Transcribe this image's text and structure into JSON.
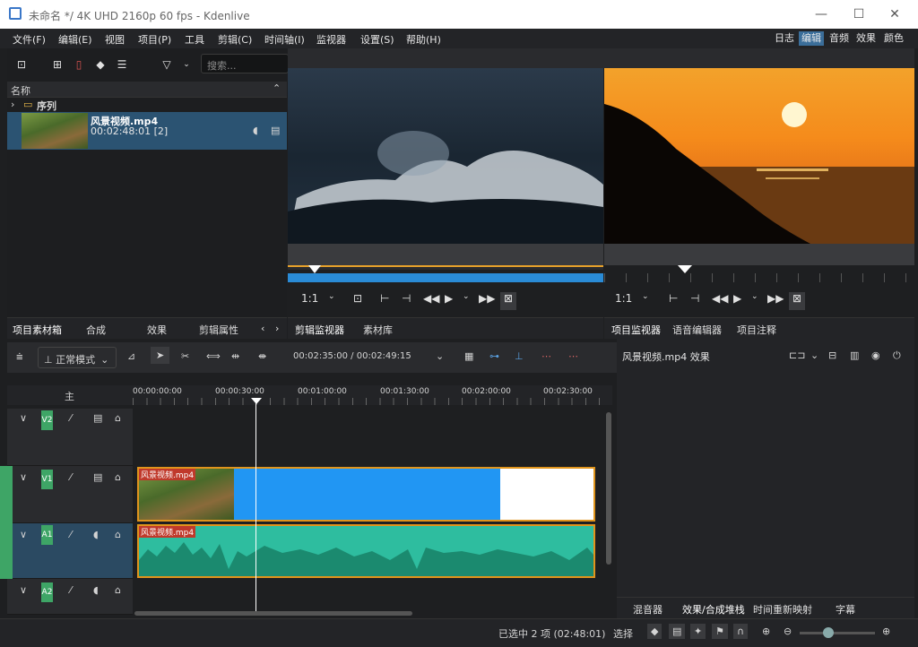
{
  "window": {
    "title": "未命名 */ 4K UHD 2160p 60 fps - Kdenlive",
    "minimize": "—",
    "maximize": "☐",
    "close": "✕"
  },
  "menus": [
    "文件(F)",
    "编辑(E)",
    "视图",
    "项目(P)",
    "工具",
    "剪辑(C)",
    "时间轴(I)",
    "监视器",
    "设置(S)",
    "帮助(H)"
  ],
  "workspaces": [
    "日志",
    "编辑",
    "音频",
    "效果",
    "颜色"
  ],
  "bin": {
    "search_placeholder": "搜索...",
    "header": "名称",
    "folder": "序列",
    "clip_name": "风景视频.mp4",
    "clip_duration": "00:02:48:01 [2]"
  },
  "left_tabs": [
    "项目素材箱",
    "合成",
    "效果",
    "剪辑属性"
  ],
  "clip_monitor": {
    "zoom": "1:1",
    "tabs": [
      "剪辑监视器",
      "素材库"
    ]
  },
  "project_monitor": {
    "zoom": "1:1",
    "tabs": [
      "项目监视器",
      "语音编辑器",
      "项目注释"
    ]
  },
  "timeline": {
    "mode": "正常模式",
    "timecode": "00:02:35:00 / 00:02:49:15",
    "master": "主",
    "ruler": [
      "00:00:00:00",
      "00:00:30:00",
      "00:01:00:00",
      "00:01:30:00",
      "00:02:00:00",
      "00:02:30:00"
    ],
    "clip_label": "风景视频.mp4"
  },
  "tracks": [
    "V2",
    "V1",
    "A1",
    "A2"
  ],
  "effects": {
    "title": "风景视频.mp4 效果",
    "tabs": [
      "混音器",
      "效果/合成堆栈",
      "时间重新映射",
      "字幕"
    ]
  },
  "status": {
    "selection": "已选中 2 项 (02:48:01)",
    "mode": "选择"
  },
  "colors": {
    "accent": "#3ea566",
    "selection": "#2b5372",
    "video_clip": "#2196f3",
    "audio_clip": "#2ebd9f",
    "clip_border": "#e0941c"
  }
}
